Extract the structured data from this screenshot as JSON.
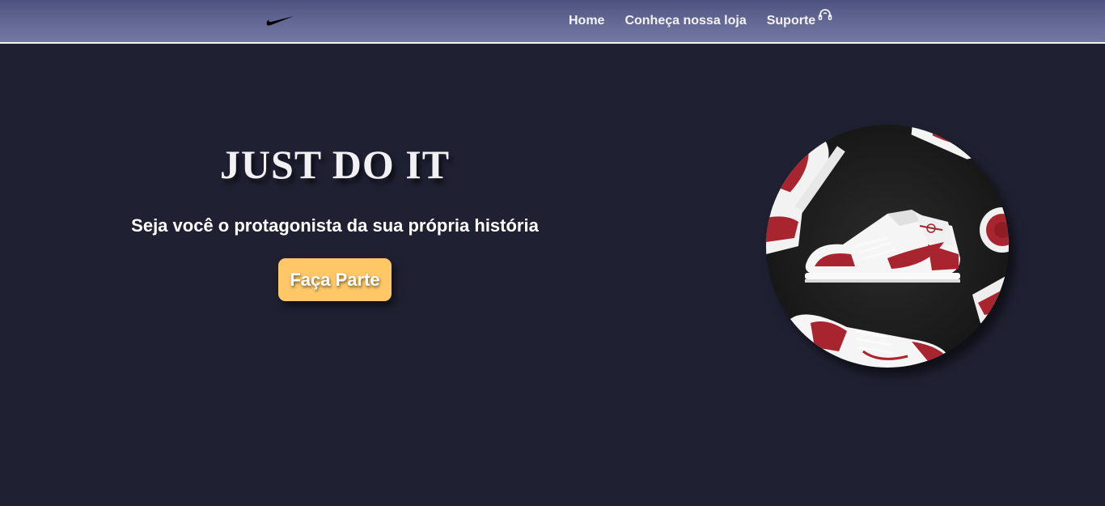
{
  "header": {
    "logo_icon": "nike-swoosh-icon",
    "nav": [
      {
        "label": "Home"
      },
      {
        "label": "Conheça nossa loja"
      },
      {
        "label": "Suporte",
        "icon": "headset-icon"
      }
    ]
  },
  "hero": {
    "title": "JUST DO IT",
    "subtitle": "Seja você o protagonista da sua própria história",
    "cta_label": "Faça Parte",
    "image_icon": "sneakers-photo"
  },
  "colors": {
    "background": "#1f2133",
    "navbar": "#6a6e9c",
    "accent": "#ffc766",
    "text": "#ffffff",
    "shoe_red": "#a8242e"
  }
}
